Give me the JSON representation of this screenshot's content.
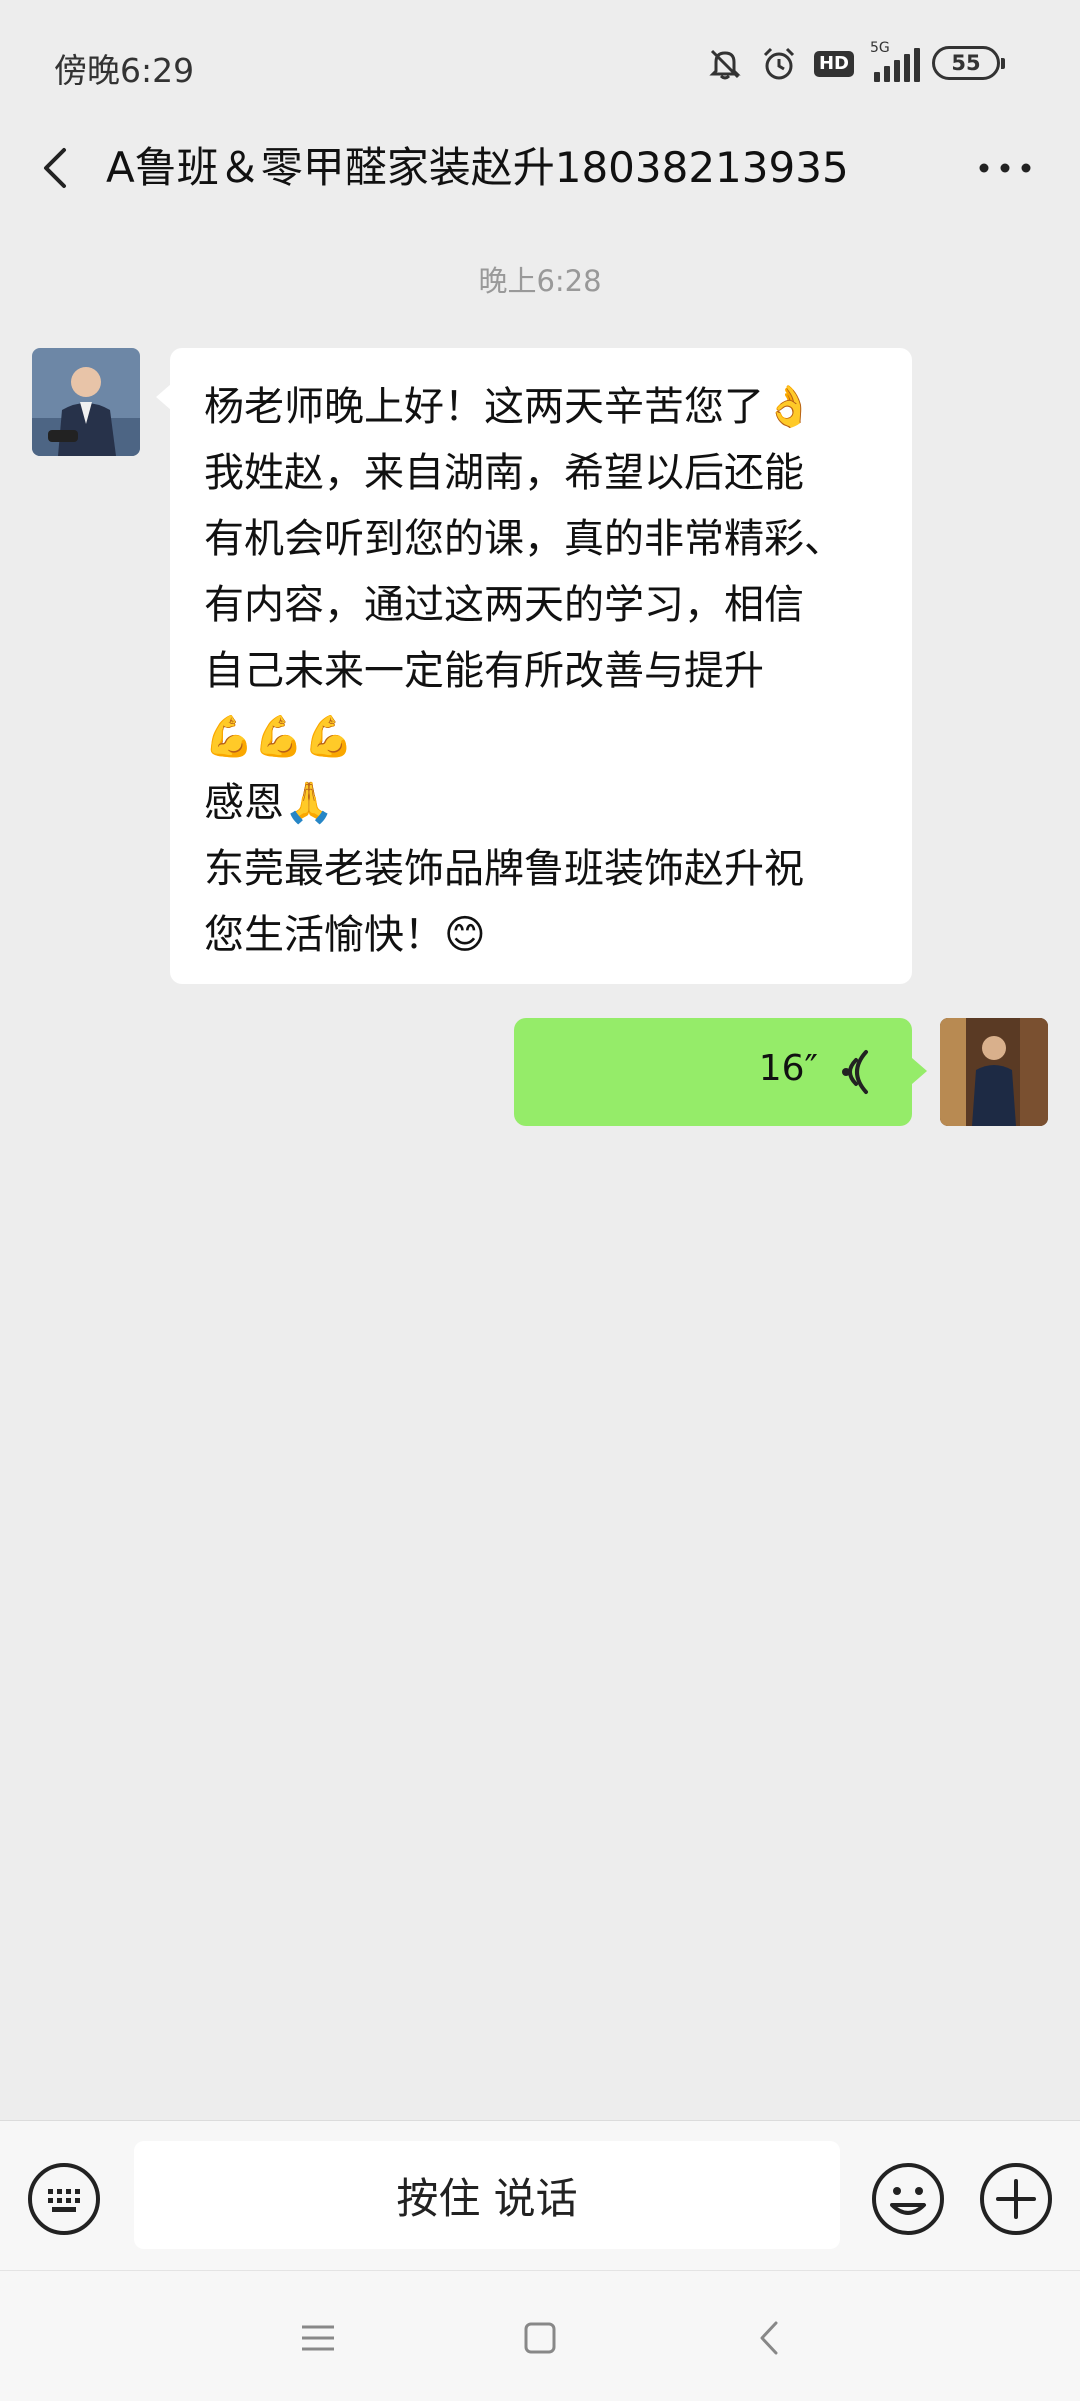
{
  "status_bar": {
    "time": "傍晚6:29",
    "network": "5G",
    "hd": "HD",
    "battery": "55",
    "icons": [
      "mute-icon",
      "alarm-icon",
      "hd-icon",
      "signal-icon",
      "battery-icon"
    ]
  },
  "header": {
    "title": "A鲁班＆零甲醛家装赵升18038213935",
    "back_icon": "chevron-left-icon",
    "more_icon": "more-dots-icon"
  },
  "chat": {
    "timestamp": "晚上6:28",
    "incoming": {
      "lines": [
        "杨老师晚上好！这两天辛苦您了👌",
        "我姓赵，来自湖南，希望以后还能",
        "有机会听到您的课，真的非常精彩、",
        "有内容，通过这两天的学习，相信",
        "自己未来一定能有所改善与提升",
        "💪💪💪",
        "感恩🙏",
        "东莞最老装饰品牌鲁班装饰赵升祝",
        "您生活愉快！😊"
      ]
    },
    "outgoing": {
      "type": "voice",
      "duration": "16″"
    }
  },
  "input_bar": {
    "hold_to_talk": "按住 说话",
    "icons": [
      "keyboard-icon",
      "emoji-icon",
      "plus-icon"
    ]
  },
  "nav_bar": {
    "icons": [
      "menu-icon",
      "home-icon",
      "back-icon"
    ]
  },
  "colors": {
    "background": "#ededed",
    "incoming_bubble": "#ffffff",
    "outgoing_bubble": "#95ec69"
  }
}
